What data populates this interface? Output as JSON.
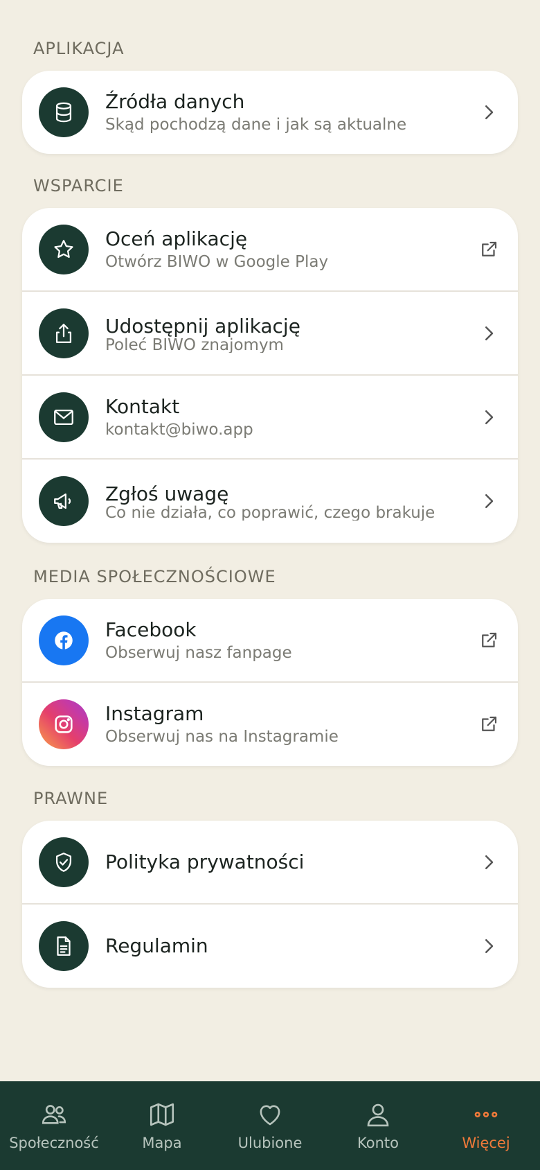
{
  "sections": {
    "app": {
      "title": "APLIKACJA",
      "items": [
        {
          "title": "Źródła danych",
          "subtitle": "Skąd pochodzą dane i jak są aktualne",
          "icon": "database-icon",
          "trail": "chevron-right-icon"
        }
      ]
    },
    "support": {
      "title": "WSPARCIE",
      "items": [
        {
          "title": "Oceń aplikację",
          "subtitle": "Otwórz BIWO w Google Play",
          "icon": "star-icon",
          "trail": "external-link-icon"
        },
        {
          "title": "Udostępnij aplikację",
          "subtitle": "Poleć BIWO znajomym",
          "icon": "share-icon",
          "trail": "chevron-right-icon"
        },
        {
          "title": "Kontakt",
          "subtitle": "kontakt@biwo.app",
          "icon": "mail-icon",
          "trail": "chevron-right-icon"
        },
        {
          "title": "Zgłoś uwagę",
          "subtitle": "Co nie działa, co poprawić, czego brakuje",
          "icon": "megaphone-icon",
          "trail": "chevron-right-icon"
        }
      ]
    },
    "social": {
      "title": "MEDIA SPOŁECZNOŚCIOWE",
      "items": [
        {
          "title": "Facebook",
          "subtitle": "Obserwuj nasz fanpage",
          "icon": "facebook-icon",
          "trail": "external-link-icon"
        },
        {
          "title": "Instagram",
          "subtitle": "Obserwuj nas na Instagramie",
          "icon": "instagram-icon",
          "trail": "external-link-icon"
        }
      ]
    },
    "legal": {
      "title": "PRAWNE",
      "items": [
        {
          "title": "Polityka prywatności",
          "icon": "shield-check-icon",
          "trail": "chevron-right-icon"
        },
        {
          "title": "Regulamin",
          "icon": "document-icon",
          "trail": "chevron-right-icon"
        }
      ]
    }
  },
  "nav": {
    "items": [
      {
        "label": "Społeczność",
        "icon": "community-icon"
      },
      {
        "label": "Mapa",
        "icon": "map-icon"
      },
      {
        "label": "Ulubione",
        "icon": "heart-icon"
      },
      {
        "label": "Konto",
        "icon": "user-icon"
      },
      {
        "label": "Więcej",
        "icon": "more-icon",
        "active": true
      }
    ]
  },
  "colors": {
    "background": "#f2eee3",
    "brand_dark": "#1b3a31",
    "accent": "#f07a3a",
    "facebook": "#1877f2"
  }
}
